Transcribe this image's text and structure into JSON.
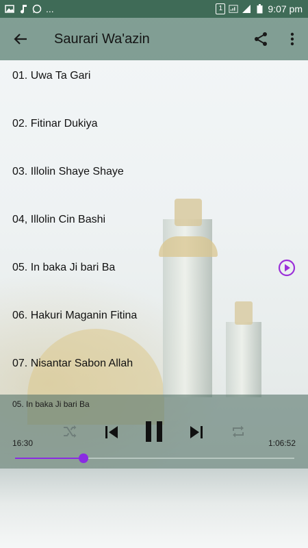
{
  "status_bar": {
    "time": "9:07 pm",
    "more_glyph": "...",
    "sim_badge": "1",
    "left_icons": [
      "image-icon",
      "music-note-icon",
      "whatsapp-icon"
    ],
    "right_icons": [
      "sim-icon",
      "wifi-icon",
      "signal-icon",
      "battery-icon"
    ]
  },
  "app_bar": {
    "title": "Saurari Wa'azin",
    "back_icon": "arrow-back-icon",
    "actions": [
      "share-icon",
      "more-vert-icon"
    ]
  },
  "tracks": [
    {
      "label": "01. Uwa Ta Gari",
      "playing": false
    },
    {
      "label": "02. Fitinar Dukiya",
      "playing": false
    },
    {
      "label": "03. Illolin Shaye Shaye",
      "playing": false
    },
    {
      "label": "04, Illolin Cin Bashi",
      "playing": false
    },
    {
      "label": "05. In baka Ji bari Ba",
      "playing": true
    },
    {
      "label": "06. Hakuri Maganin Fitina",
      "playing": false
    },
    {
      "label": "07. Nisantar Sabon Allah",
      "playing": false
    }
  ],
  "player": {
    "now_playing": "05. In baka Ji bari Ba",
    "elapsed": "16:30",
    "duration": "1:06:52",
    "progress": 0.246,
    "controls": [
      "shuffle-icon",
      "previous-icon",
      "pause-icon",
      "next-icon",
      "repeat-icon"
    ]
  },
  "colors": {
    "status_bar": "#3f6b57",
    "accent": "#8a2be2",
    "play_indicator": "#9b30d9"
  }
}
